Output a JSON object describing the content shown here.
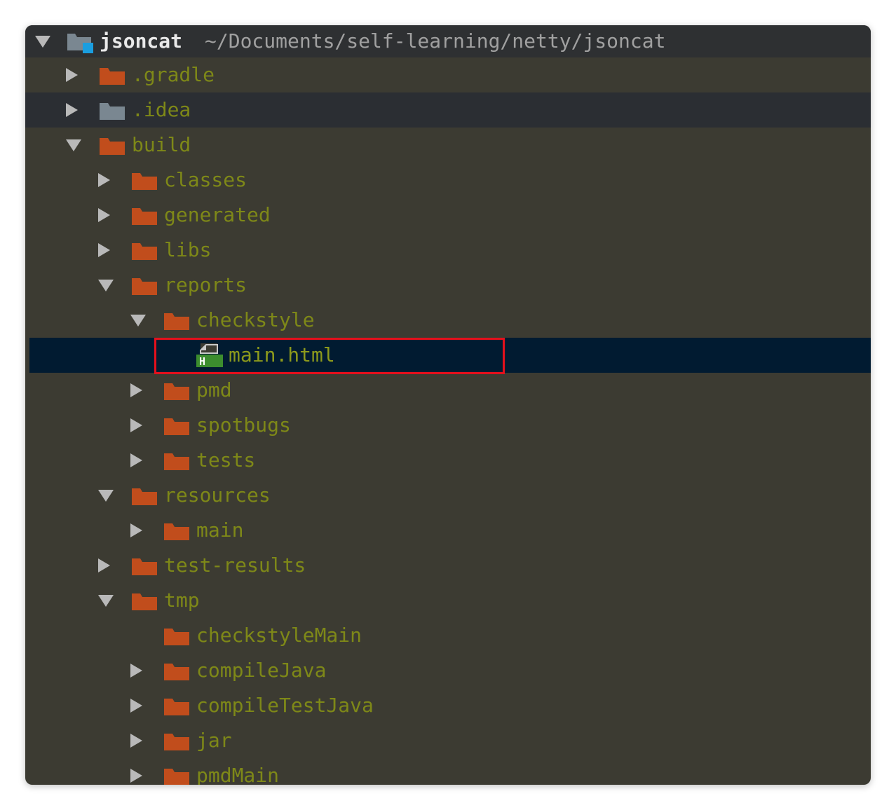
{
  "project": {
    "name": "jsoncat",
    "path": "~/Documents/self-learning/netty/jsoncat"
  },
  "colors": {
    "background": "#3c3b32",
    "folder": "#c14d1c",
    "folder_grey": "#7a8791",
    "text": "#7e8818",
    "selection": "#011b31",
    "highlight_box": "#e4101c",
    "module_badge": "#1a9ee0",
    "html_icon": "#3c8d2e"
  },
  "tree": [
    {
      "id": "gradle",
      "label": ".gradle",
      "arrow": "right",
      "icon": "folder-icon"
    },
    {
      "id": "idea",
      "label": ".idea",
      "arrow": "right",
      "icon": "folder-grey-icon"
    },
    {
      "id": "build",
      "label": "build",
      "arrow": "down",
      "icon": "folder-icon"
    },
    {
      "id": "classes",
      "label": "classes",
      "arrow": "right",
      "icon": "folder-icon"
    },
    {
      "id": "generated",
      "label": "generated",
      "arrow": "right",
      "icon": "folder-icon"
    },
    {
      "id": "libs",
      "label": "libs",
      "arrow": "right",
      "icon": "folder-icon"
    },
    {
      "id": "reports",
      "label": "reports",
      "arrow": "down",
      "icon": "folder-icon"
    },
    {
      "id": "checkstyle",
      "label": "checkstyle",
      "arrow": "down",
      "icon": "folder-icon"
    },
    {
      "id": "main-html",
      "label": "main.html",
      "arrow": "none",
      "icon": "html-file-icon"
    },
    {
      "id": "pmd",
      "label": "pmd",
      "arrow": "right",
      "icon": "folder-icon"
    },
    {
      "id": "spotbugs",
      "label": "spotbugs",
      "arrow": "right",
      "icon": "folder-icon"
    },
    {
      "id": "tests",
      "label": "tests",
      "arrow": "right",
      "icon": "folder-icon"
    },
    {
      "id": "resources",
      "label": "resources",
      "arrow": "down",
      "icon": "folder-icon"
    },
    {
      "id": "main",
      "label": "main",
      "arrow": "right",
      "icon": "folder-icon"
    },
    {
      "id": "test-results",
      "label": "test-results",
      "arrow": "right",
      "icon": "folder-icon"
    },
    {
      "id": "tmp",
      "label": "tmp",
      "arrow": "down",
      "icon": "folder-icon"
    },
    {
      "id": "checkstyleMain",
      "label": "checkstyleMain",
      "arrow": "none",
      "icon": "folder-icon"
    },
    {
      "id": "compileJava",
      "label": "compileJava",
      "arrow": "right",
      "icon": "folder-icon"
    },
    {
      "id": "compileTestJava",
      "label": "compileTestJava",
      "arrow": "right",
      "icon": "folder-icon"
    },
    {
      "id": "jar",
      "label": "jar",
      "arrow": "right",
      "icon": "folder-icon"
    },
    {
      "id": "pmdMain",
      "label": "pmdMain",
      "arrow": "right",
      "icon": "folder-icon"
    }
  ],
  "html_icon_letter": "H"
}
